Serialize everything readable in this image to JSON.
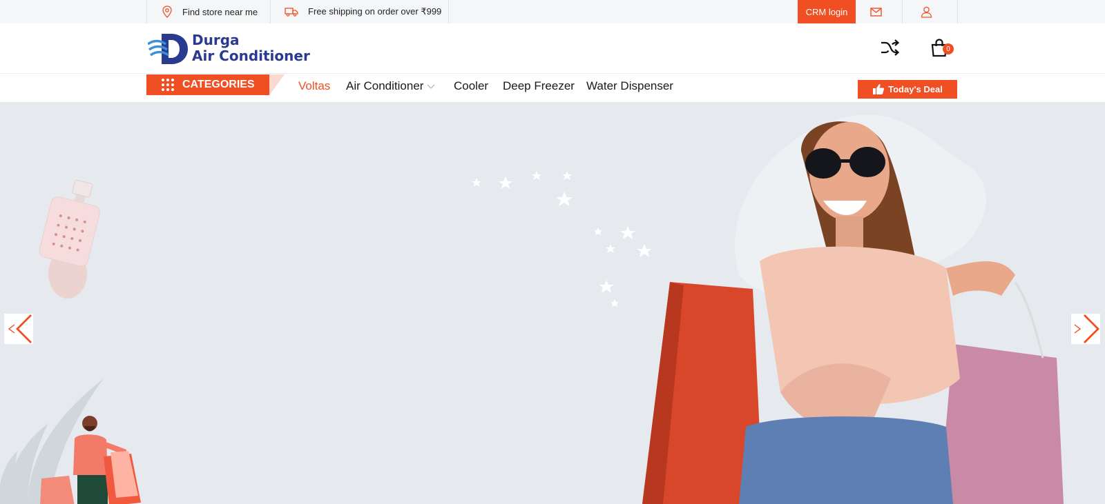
{
  "topbar": {
    "store_label": "Find store near me",
    "shipping_label": "Free shipping on order over ₹999",
    "crm_label": "CRM login"
  },
  "header": {
    "logo_line1": "Durga",
    "logo_line2": "Air Conditioner",
    "cart_count": "0"
  },
  "nav": {
    "categories_label": "CATEGORIES",
    "links": [
      "Voltas",
      "Air Conditioner",
      "Cooler",
      "Deep Freezer",
      "Water Dispenser"
    ],
    "deal_label": "Today's Deal"
  },
  "colors": {
    "accent": "#f04e23",
    "brand_blue": "#2a3a8f",
    "hero_bg": "#e6eaee"
  },
  "icons": [
    "location-pin-icon",
    "truck-icon",
    "mail-icon",
    "user-icon",
    "shuffle-icon",
    "cart-icon",
    "thumbs-up-icon",
    "grid-icon",
    "chevron-down-icon",
    "arrow-left-icon",
    "arrow-right-icon"
  ]
}
